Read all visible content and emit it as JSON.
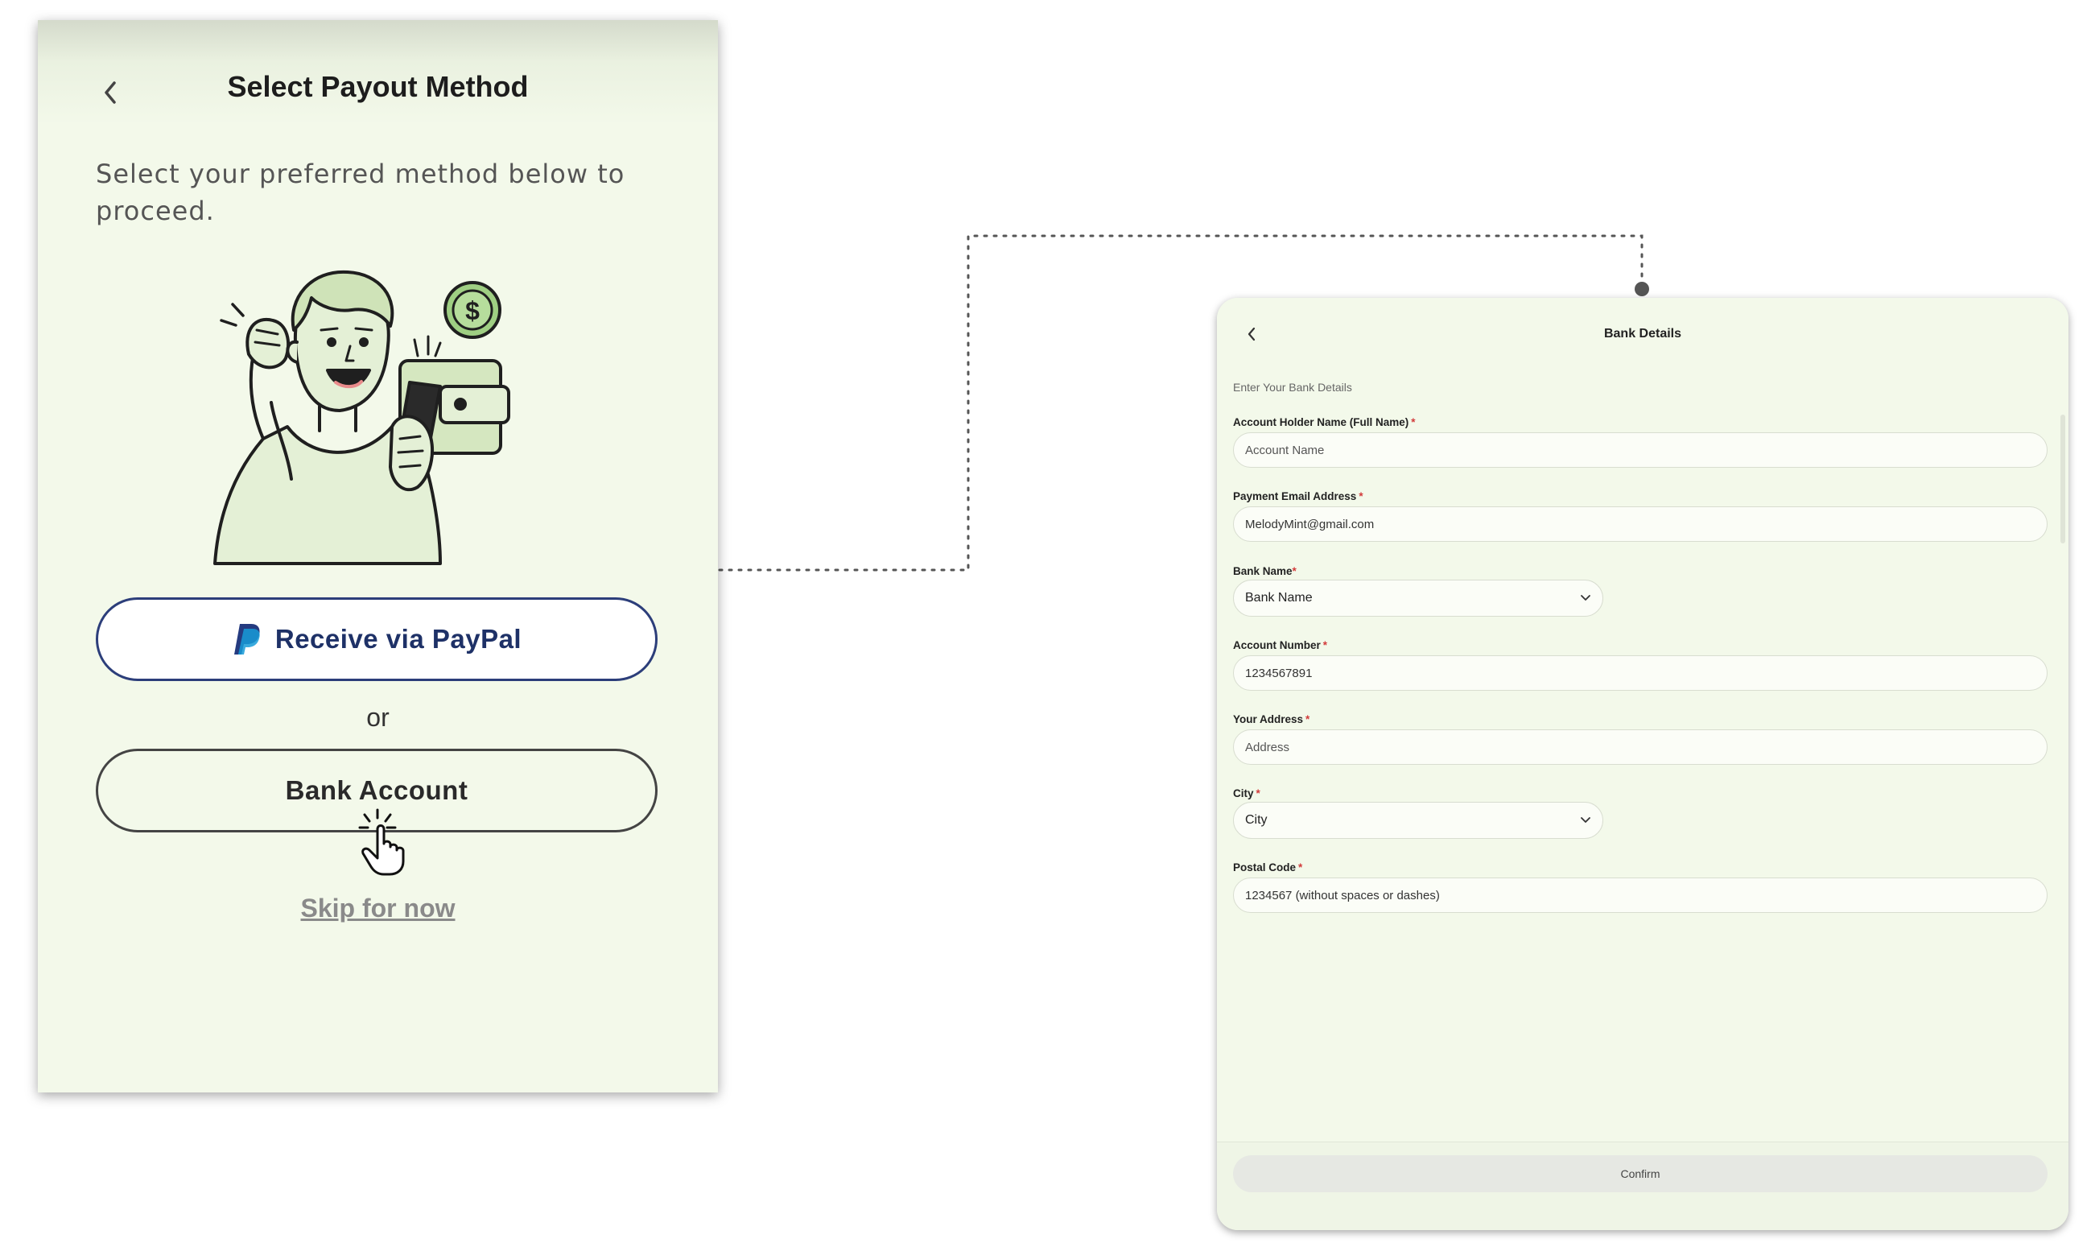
{
  "payout_screen": {
    "title": "Select Payout Method",
    "subtitle": "Select your preferred method below to proceed.",
    "paypal_button": "Receive via PayPal",
    "or_text": "or",
    "bank_button": "Bank Account",
    "skip_link": "Skip for now"
  },
  "bank_screen": {
    "title": "Bank Details",
    "subtitle": "Enter Your Bank Details",
    "fields": {
      "account_holder": {
        "label": "Account Holder Name (Full Name)",
        "required_mark": "*",
        "placeholder": "Account Name",
        "value": ""
      },
      "email": {
        "label": "Payment Email Address",
        "required_mark": "*",
        "placeholder": "",
        "value": "MelodyMint@gmail.com"
      },
      "bank_name": {
        "label": "Bank Name",
        "required_mark": "*",
        "selected": "Bank Name"
      },
      "account_number": {
        "label": "Account Number",
        "required_mark": "*",
        "placeholder": "",
        "value": "1234567891"
      },
      "address": {
        "label": "Your Address",
        "required_mark": "*",
        "placeholder": "Address",
        "value": ""
      },
      "city": {
        "label": "City",
        "required_mark": "*",
        "selected": "City"
      },
      "postal_code": {
        "label": "Postal Code",
        "required_mark": "*",
        "placeholder": "",
        "value": "1234567 (without spaces or dashes)"
      }
    },
    "confirm_button": "Confirm"
  },
  "icons": {
    "back": "chevron-left-icon",
    "paypal": "paypal-logo-icon",
    "dropdown": "chevron-down-icon",
    "cursor": "hand-pointer-click-icon",
    "money": "dollar-coin-icon"
  },
  "colors": {
    "screen_background": "#f3f9ea",
    "paypal_text": "#1e3167",
    "required_mark": "#d23b3b",
    "confirm_disabled": "#e6e8e3"
  }
}
